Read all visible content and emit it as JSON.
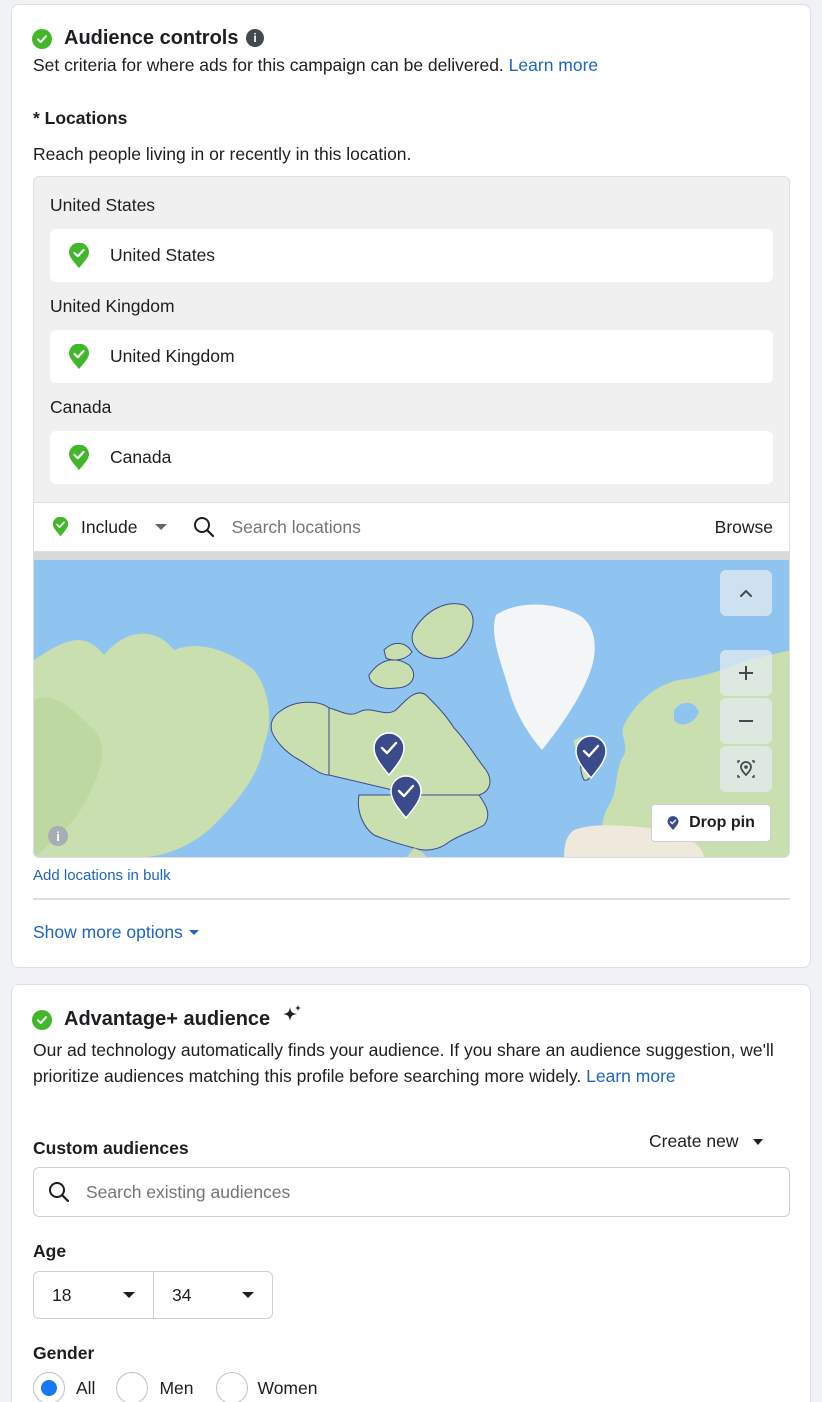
{
  "audience_controls": {
    "title": "Audience controls",
    "description": "Set criteria for where ads for this campaign can be delivered.",
    "learn_more": "Learn more",
    "locations_label": "* Locations",
    "locations_help": "Reach people living in or recently in this location.",
    "location_groups": [
      {
        "group": "United States",
        "item": "United States"
      },
      {
        "group": "United Kingdom",
        "item": "United Kingdom"
      },
      {
        "group": "Canada",
        "item": "Canada"
      }
    ],
    "include_label": "Include",
    "search_placeholder": "Search locations",
    "browse_label": "Browse",
    "drop_pin_label": "Drop pin",
    "bulk_link": "Add locations in bulk",
    "show_more": "Show more options",
    "map_info": "i"
  },
  "advantage_audience": {
    "title": "Advantage+ audience",
    "description": "Our ad technology automatically finds your audience. If you share an audience suggestion, we'll prioritize audiences matching this profile before searching more widely.",
    "learn_more": "Learn more",
    "custom_audiences_label": "Custom audiences",
    "create_new": "Create new",
    "search_placeholder": "Search existing audiences",
    "age_label": "Age",
    "age_min": "18",
    "age_max": "34",
    "gender_label": "Gender",
    "gender_options": [
      "All",
      "Men",
      "Women"
    ],
    "gender_selected": "All"
  },
  "colors": {
    "accent": "#1877f2",
    "link": "#1d65c1",
    "check_green": "#42b72a",
    "pin_navy": "#3b4a8a"
  }
}
